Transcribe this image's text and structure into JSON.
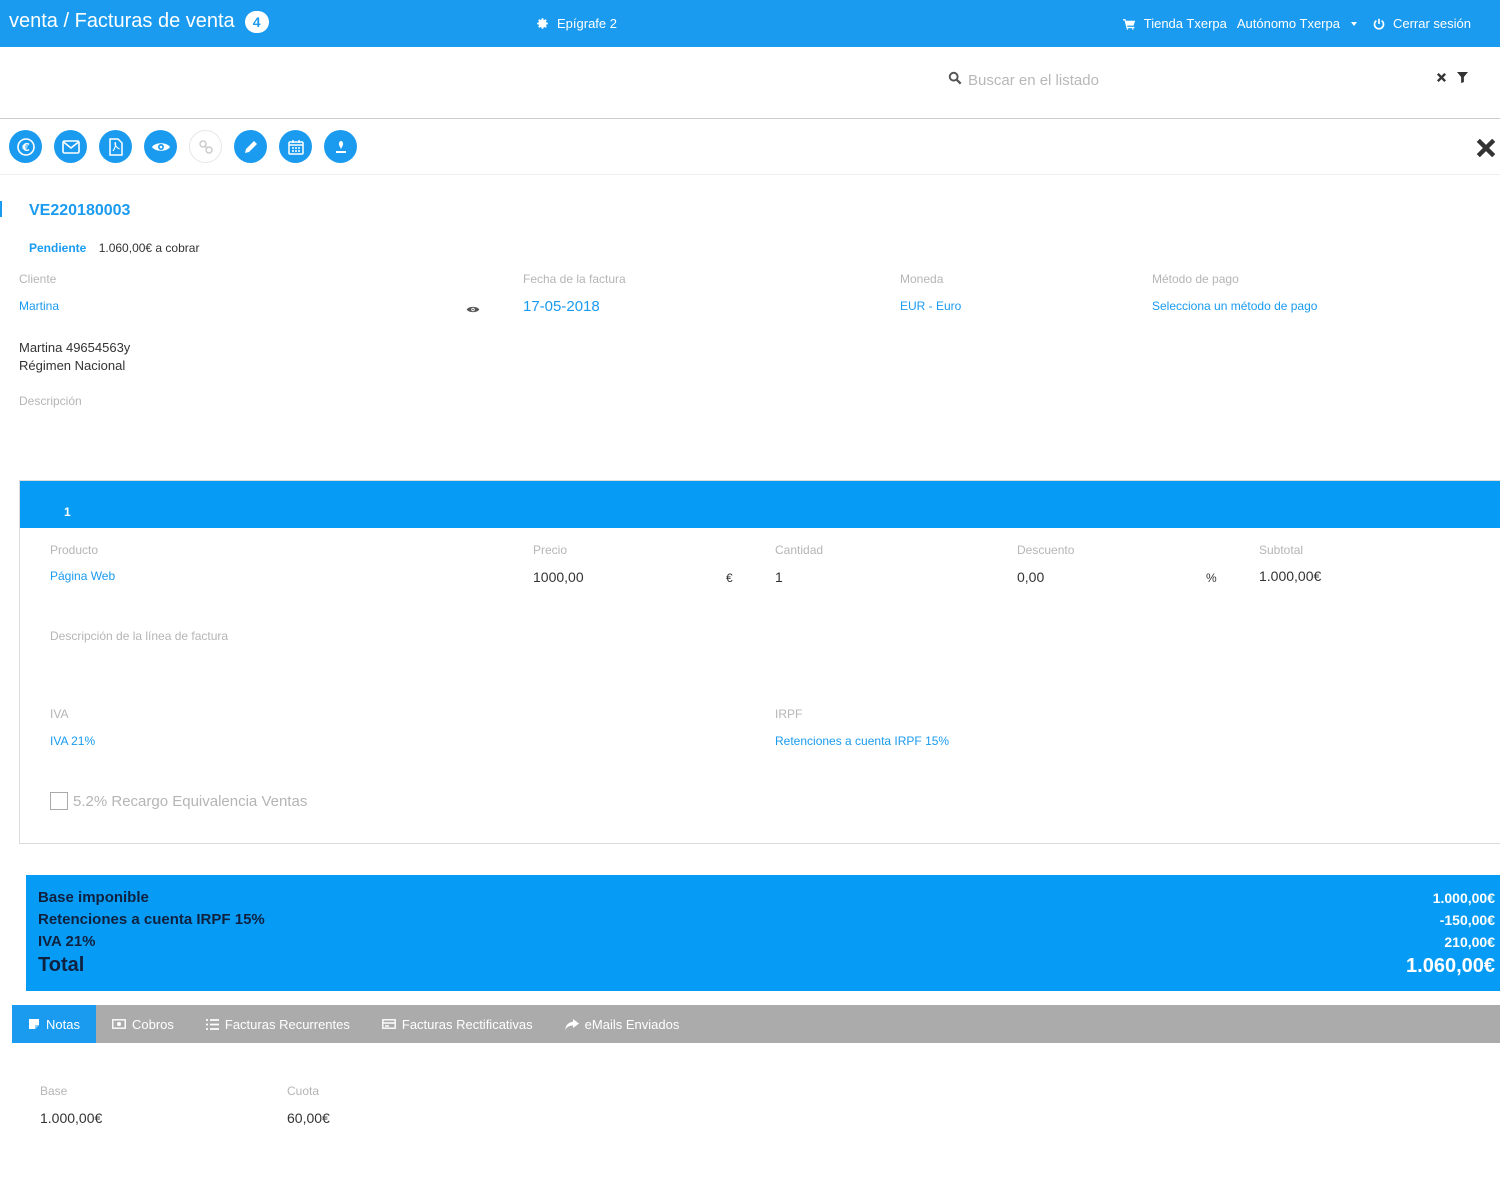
{
  "header": {
    "breadcrumb": "venta / Facturas de venta",
    "badge_count": "4",
    "epigrafe": "Epígrafe 2",
    "store": "Tienda Txerpa",
    "user": "Autónomo Txerpa",
    "logout": "Cerrar sesión"
  },
  "search": {
    "placeholder": "Buscar en el listado",
    "value": ""
  },
  "toolbar": {
    "buttons": [
      "euro-icon",
      "envelope-icon",
      "pdf-icon",
      "eye-icon",
      "link-icon",
      "pencil-icon",
      "calendar-icon",
      "stamp-icon"
    ]
  },
  "invoice": {
    "number": "VE220180003",
    "status": "Pendiente",
    "pending_text": "1.060,00€ a cobrar",
    "client_label": "Cliente",
    "client_value": "Martina",
    "date_label": "Fecha de la factura",
    "date_value": "17-05-2018",
    "currency_label": "Moneda",
    "currency_value": "EUR - Euro",
    "payment_label": "Método de pago",
    "payment_value": "Selecciona un método de pago",
    "client_line1": "Martina 49654563y",
    "client_line2": "Régimen Nacional",
    "description_label": "Descripción"
  },
  "line": {
    "index": "1",
    "product_label": "Producto",
    "product_value": "Página Web",
    "price_label": "Precio",
    "price_value": "1000,00",
    "price_currency": "€",
    "quantity_label": "Cantidad",
    "quantity_value": "1",
    "discount_label": "Descuento",
    "discount_value": "0,00",
    "discount_unit": "%",
    "subtotal_label": "Subtotal",
    "subtotal_value": "1.000,00€",
    "line_desc_label": "Descripción de la línea de factura",
    "iva_label": "IVA",
    "iva_value": "IVA 21%",
    "irpf_label": "IRPF",
    "irpf_value": "Retenciones a cuenta IRPF 15%",
    "recargo_label": "5.2% Recargo Equivalencia Ventas",
    "recargo_checked": false
  },
  "totals": {
    "base_label": "Base imponible",
    "base_value": "1.000,00€",
    "irpf_label": "Retenciones a cuenta IRPF 15%",
    "irpf_value": "-150,00€",
    "iva_label": "IVA 21%",
    "iva_value": "210,00€",
    "total_label": "Total",
    "total_value": "1.060,00€"
  },
  "tabs": [
    {
      "label": "Notas",
      "icon": "note-icon",
      "active": true
    },
    {
      "label": "Cobros",
      "icon": "cash-icon",
      "active": false
    },
    {
      "label": "Facturas Recurrentes",
      "icon": "list-icon",
      "active": false
    },
    {
      "label": "Facturas Rectificativas",
      "icon": "card-icon",
      "active": false
    },
    {
      "label": "eMails Enviados",
      "icon": "share-icon",
      "active": false
    }
  ],
  "footer": {
    "base_label": "Base",
    "base_value": "1.000,00€",
    "cuota_label": "Cuota",
    "cuota_value": "60,00€"
  },
  "colors": {
    "primary": "#1a9bf0",
    "totals_bg": "#069cf6",
    "tabs_bg": "#ababab",
    "label": "#b5b5b5"
  }
}
